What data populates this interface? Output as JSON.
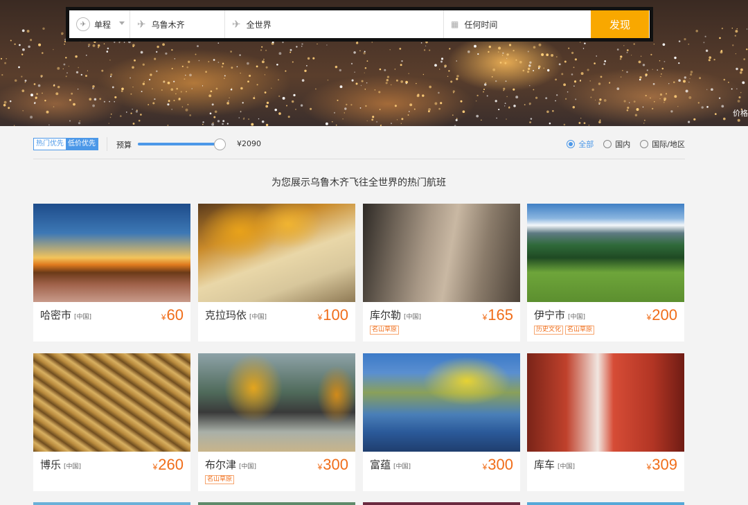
{
  "search": {
    "trip_type": "单程",
    "from": "乌鲁木齐",
    "to": "全世界",
    "date": "任何时间",
    "find_label": "发现"
  },
  "hero": {
    "corner_text": "价格"
  },
  "filter": {
    "sort_hot": "热门优先",
    "sort_low": "低价优先",
    "budget_label": "预算",
    "budget_value": "¥2090",
    "budget_fraction": 0.92,
    "region_options": [
      "全部",
      "国内",
      "国际/地区"
    ],
    "region_selected": "全部"
  },
  "headline": "为您展示乌鲁木齐飞往全世界的热门航班",
  "currency": "¥",
  "colors": {
    "accent": "#f9a800",
    "price": "#f06d19",
    "link": "#4c98e8"
  },
  "destinations": [
    {
      "name": "哈密市",
      "country": "[中国]",
      "price": "60",
      "tags": []
    },
    {
      "name": "克拉玛依",
      "country": "[中国]",
      "price": "100",
      "tags": []
    },
    {
      "name": "库尔勒",
      "country": "[中国]",
      "price": "165",
      "tags": [
        "名山草原"
      ]
    },
    {
      "name": "伊宁市",
      "country": "[中国]",
      "price": "200",
      "tags": [
        "历史文化",
        "名山草原"
      ]
    },
    {
      "name": "博乐",
      "country": "[中国]",
      "price": "260",
      "tags": []
    },
    {
      "name": "布尔津",
      "country": "[中国]",
      "price": "300",
      "tags": [
        "名山草原"
      ]
    },
    {
      "name": "富蕴",
      "country": "[中国]",
      "price": "300",
      "tags": []
    },
    {
      "name": "库车",
      "country": "[中国]",
      "price": "309",
      "tags": []
    }
  ]
}
